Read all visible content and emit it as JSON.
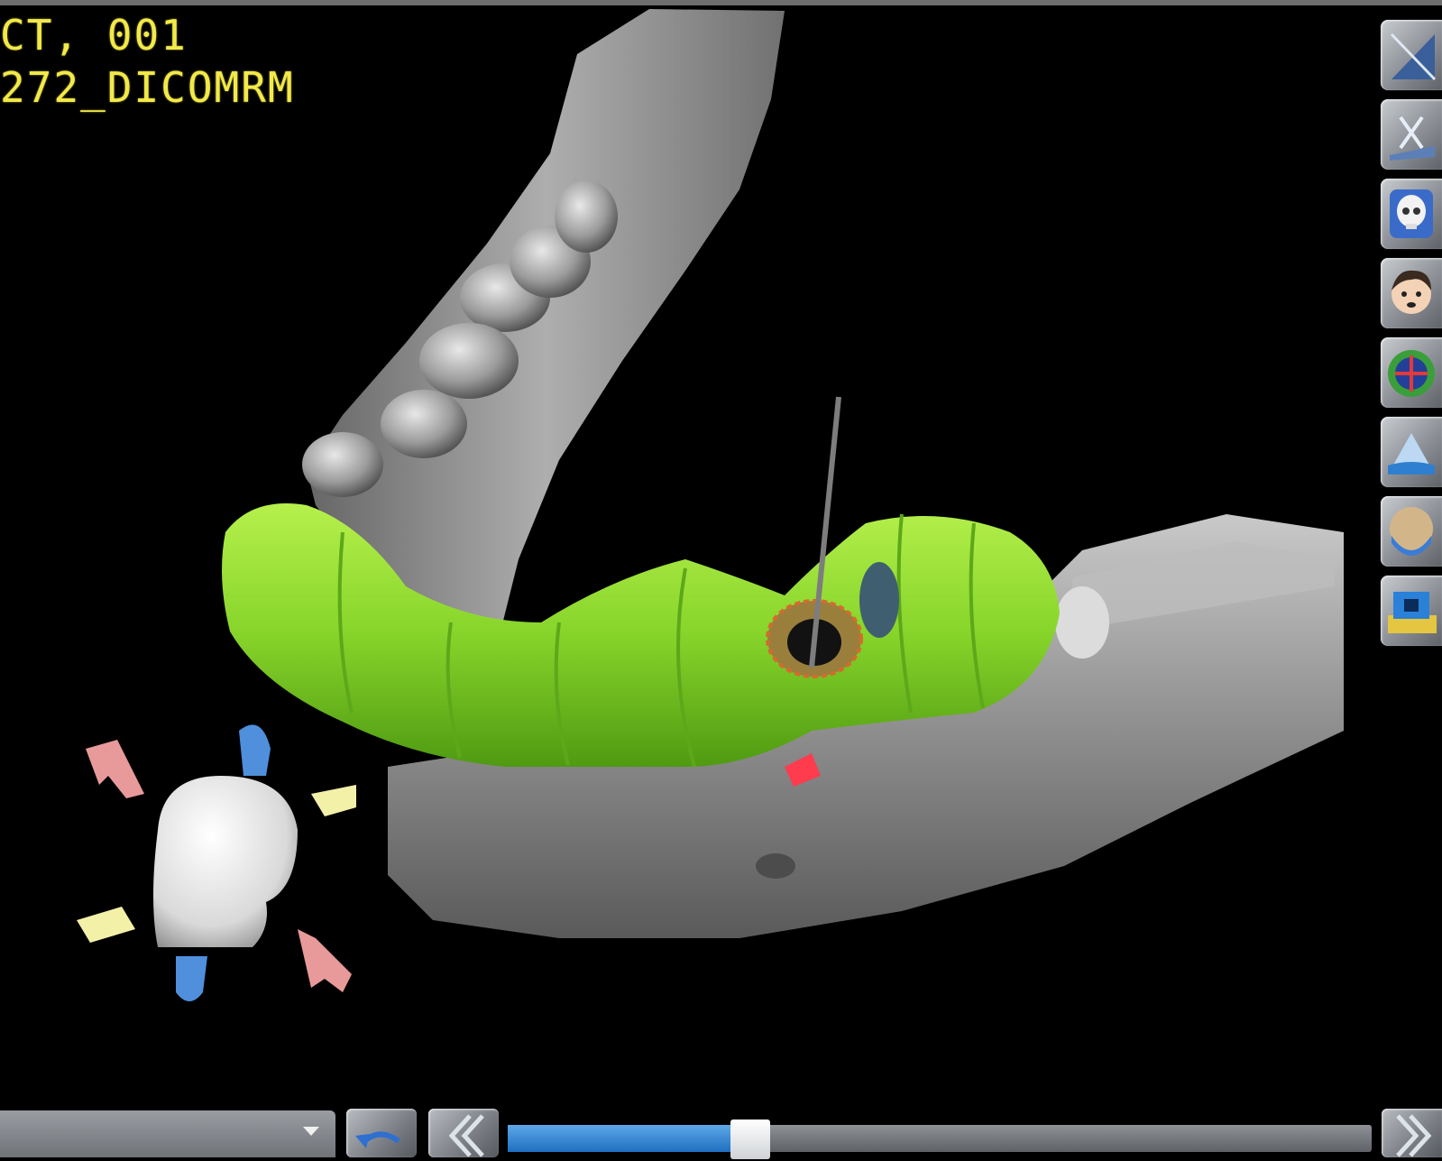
{
  "overlay": {
    "line1": "CT, 001",
    "line2": "272_DICOMRM"
  },
  "toolbar": {
    "tools": [
      {
        "name": "slice-plane-tool",
        "icon": "slice-plane-icon"
      },
      {
        "name": "cut-tool",
        "icon": "scissors-plane-icon"
      },
      {
        "name": "skull-view-tool",
        "icon": "skull-icon"
      },
      {
        "name": "face-view-tool",
        "icon": "face-icon"
      },
      {
        "name": "nerve-tool",
        "icon": "nerve-ring-icon"
      },
      {
        "name": "bone-density-tool",
        "icon": "mountain-icon"
      },
      {
        "name": "arch-view-tool",
        "icon": "arch-icon"
      },
      {
        "name": "implant-library-tool",
        "icon": "implant-box-icon"
      }
    ]
  },
  "bottom": {
    "slider_level": 0.26
  },
  "colors": {
    "overlay_text": "#f2e94a",
    "guide": "#8bd82e",
    "bone": "#9a9a9a",
    "slider_fill": "#2a7fd4"
  }
}
